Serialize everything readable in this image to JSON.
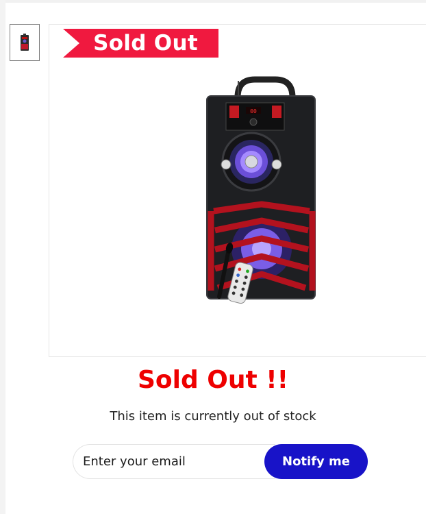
{
  "gallery": {
    "thumbnail_icon": "speaker-thumbnail-icon",
    "product_icon": "party-speaker-with-microphone-and-remote"
  },
  "ribbon": {
    "label": "Sold Out",
    "color": "#f0193f"
  },
  "status": {
    "title": "Sold Out !!",
    "message": "This item is currently out of stock",
    "title_color": "#ee0000"
  },
  "notify": {
    "email_placeholder": "Enter your email",
    "button_label": "Notify me",
    "button_color": "#1813c8"
  }
}
